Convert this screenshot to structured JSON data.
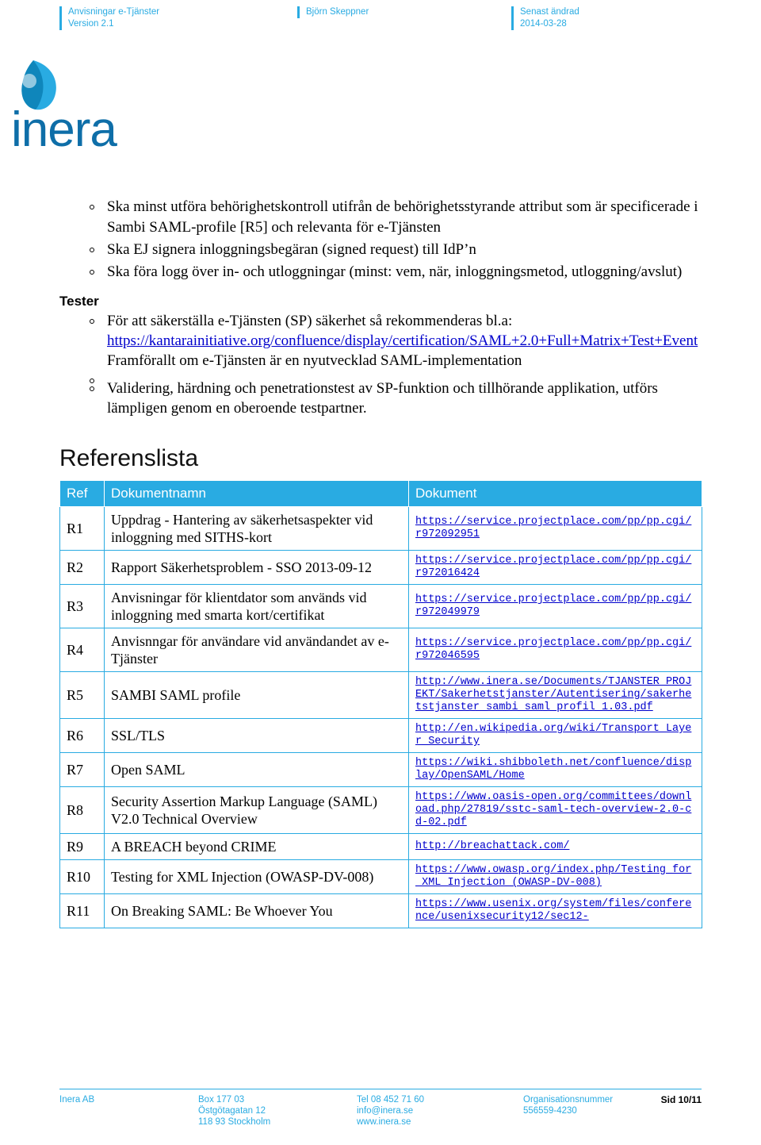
{
  "header": {
    "col1_line1": "Anvisningar e-Tjänster",
    "col1_line2": "Version 2.1",
    "col2_line1": "Björn Skeppner",
    "col3_line1": "Senast ändrad",
    "col3_line2": "2014-03-28"
  },
  "logo": {
    "wordmark": "inera"
  },
  "bullets": [
    "Ska minst utföra behörighetskontroll utifrån de behörighetsstyrande attribut som är specificerade i Sambi SAML-profile [R5] och relevanta för e-Tjänsten",
    "Ska EJ signera inloggningsbegäran (signed request) till IdP’n",
    "Ska föra logg över in- och utloggningar (minst: vem, när, inloggningsmetod, utloggning/avslut)"
  ],
  "tester": {
    "heading": "Tester",
    "item1_prefix": "För att säkerställa e-Tjänsten (SP) säkerhet så rekommenderas bl.a:",
    "item1_link": "https://kantarainitiative.org/confluence/display/certification/SAML+2.0+Full+Matrix+Test+Event",
    "item1_suffix": "Framförallt om e-Tjänsten är en nyutvecklad SAML-implementation",
    "item2": "Validering, härdning och penetrationstest av SP-funktion och tillhörande applikation, utförs lämpligen genom en oberoende testpartner."
  },
  "references": {
    "title": "Referenslista",
    "columns": [
      "Ref",
      "Dokumentnamn",
      "Dokument"
    ],
    "rows": [
      {
        "ref": "R1",
        "name": "Uppdrag - Hantering av säkerhetsaspekter vid inloggning med SITHS-kort",
        "url": "https://service.projectplace.com/pp/pp.cgi/r972092951"
      },
      {
        "ref": "R2",
        "name": "Rapport Säkerhetsproblem - SSO 2013-09-12",
        "url": "https://service.projectplace.com/pp/pp.cgi/r972016424"
      },
      {
        "ref": "R3",
        "name": "Anvisningar för klientdator som används vid inloggning med smarta kort/certifikat",
        "url": "https://service.projectplace.com/pp/pp.cgi/r972049979"
      },
      {
        "ref": "R4",
        "name": "Anvisnngar för användare vid användandet av e-Tjänster",
        "url": "https://service.projectplace.com/pp/pp.cgi/r972046595"
      },
      {
        "ref": "R5",
        "name": "SAMBI SAML profile",
        "url": "http://www.inera.se/Documents/TJANSTER PROJEKT/Sakerhetstjanster/Autentisering/sakerhetstjanster_sambi_saml_profil_1.03.pdf"
      },
      {
        "ref": "R6",
        "name": "SSL/TLS",
        "url": "http://en.wikipedia.org/wiki/Transport_Layer_Security"
      },
      {
        "ref": "R7",
        "name": "Open SAML",
        "url": "https://wiki.shibboleth.net/confluence/display/OpenSAML/Home"
      },
      {
        "ref": "R8",
        "name": "Security Assertion Markup Language (SAML) V2.0 Technical Overview",
        "url": "https://www.oasis-open.org/committees/download.php/27819/sstc-saml-tech-overview-2.0-cd-02.pdf"
      },
      {
        "ref": "R9",
        "name": "A BREACH beyond CRIME",
        "url": "http://breachattack.com/"
      },
      {
        "ref": "R10",
        "name": "Testing for XML Injection (OWASP-DV-008)",
        "url": "https://www.owasp.org/index.php/Testing_for_XML_Injection_(OWASP-DV-008)"
      },
      {
        "ref": "R11",
        "name": "On Breaking SAML: Be Whoever You",
        "url": "https://www.usenix.org/system/files/conference/usenixsecurity12/sec12-"
      }
    ]
  },
  "footer": {
    "col1_line1": "Inera AB",
    "col2_line1": "Box 177 03",
    "col2_line2": "Östgötagatan 12",
    "col2_line3": "118 93 Stockholm",
    "col3_line1": "Tel 08 452 71 60",
    "col3_line2": "info@inera.se",
    "col3_line3": "www.inera.se",
    "col4_line1": "Organisationsnummer",
    "col4_line2": "556559-4230",
    "col5_line1": "Sid 10/11"
  },
  "colors": {
    "accent": "#29abe2",
    "link": "#0000cc"
  }
}
